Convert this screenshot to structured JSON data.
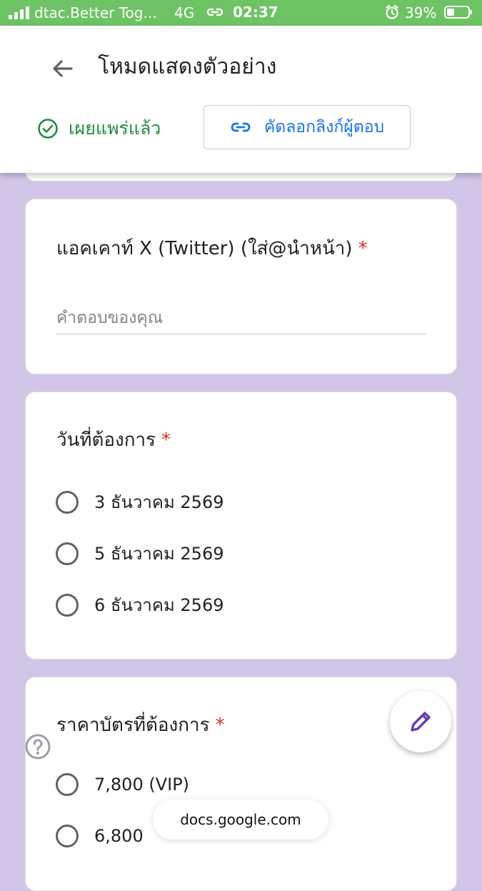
{
  "status_bar": {
    "carrier": "dtac.Better Tog...",
    "network": "4G",
    "time": "02:37",
    "battery": "39%"
  },
  "header": {
    "title": "โหมดแสดงตัวอย่าง",
    "published_label": "เผยแพร่แล้ว",
    "copy_link_label": "คัดลอกลิงก์ผู้ตอบ"
  },
  "questions": [
    {
      "title": "แอคเคาท์ X (Twitter) (ใส่@นำหน้า)",
      "required_mark": "*",
      "placeholder": "คำตอบของคุณ"
    },
    {
      "title": "วันที่ต้องการ",
      "required_mark": "*",
      "options": [
        "3 ธันวาคม 2569",
        "5 ธันวาคม 2569",
        "6 ธันวาคม 2569"
      ]
    },
    {
      "title": "ราคาบัตรที่ต้องการ",
      "required_mark": "*",
      "options": [
        "7,800 (VIP)",
        "6,800"
      ]
    }
  ],
  "browser": {
    "url": "docs.google.com"
  },
  "icons": {
    "back": "arrow-back-icon",
    "published": "check-circle-icon",
    "copy_link": "link-icon",
    "edit": "pencil-icon",
    "help": "help-icon"
  },
  "colors": {
    "status_bar": "#6ec364",
    "background": "#d2c6e8",
    "published": "#1e8e3e",
    "link": "#1a73e8",
    "required": "#d93025",
    "edit_icon": "#673ab7"
  }
}
